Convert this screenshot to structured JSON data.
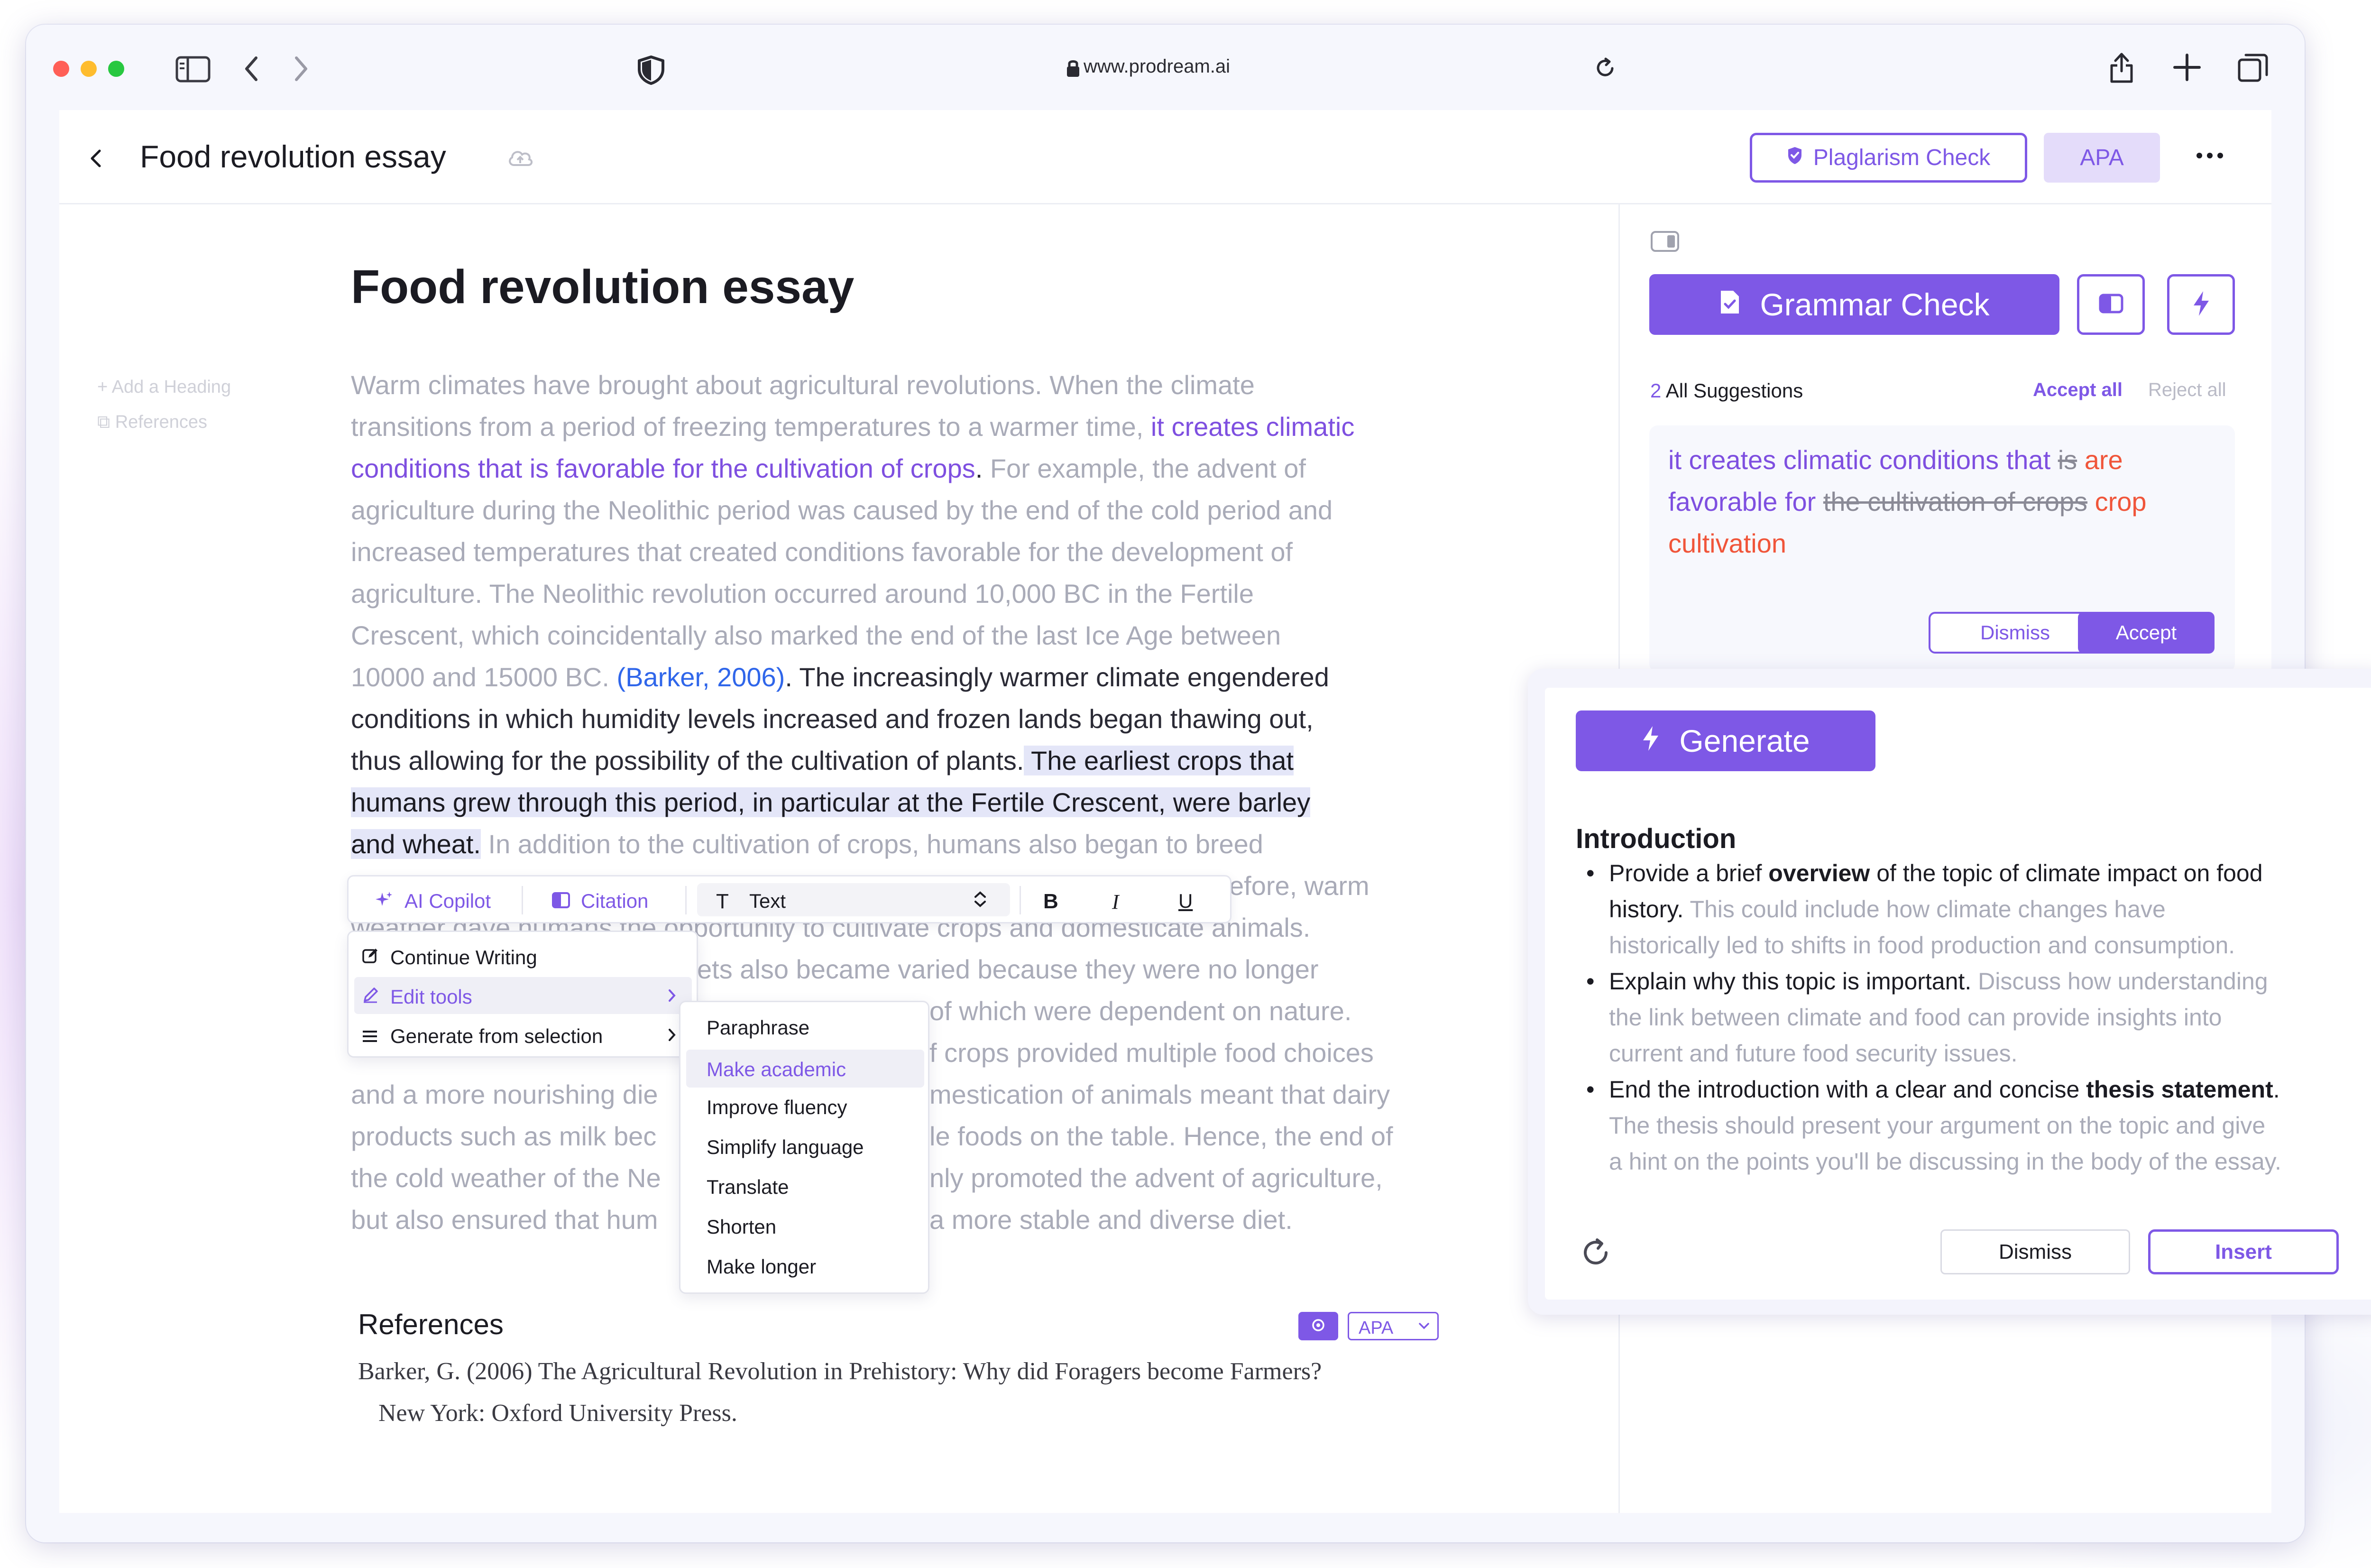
{
  "browser": {
    "url": "www.prodream.ai"
  },
  "header": {
    "title": "Food revolution essay",
    "plagiarism_label": "Plaglarism Check",
    "style_label": "APA"
  },
  "outline": {
    "add_heading": "Add a Heading",
    "references": "References"
  },
  "document": {
    "heading": "Food revolution essay",
    "l1": "Warm climates have brought about agricultural revolutions. When the climate",
    "l2a": "transitions from a period of freezing temperatures to a warmer time,",
    "l2b": " it creates climatic",
    "l3a": "conditions that is favorable for the cultivation of crops",
    "l3b": ".",
    "l3c": " For example, the advent of",
    "l4": "agriculture during the Neolithic period was caused by the end of the cold period and",
    "l5": "increased temperatures that created conditions favorable for the development of",
    "l6": "agriculture. The Neolithic revolution occurred around 10,000 BC in the Fertile",
    "l7": "Crescent, which coincidentally also marked the end of the last Ice Age between",
    "l8a": "10000 and 15000 BC.",
    "l8b": " (Barker, 2006)",
    "l8c": ". The increasingly warmer climate engendered",
    "l9": "conditions in which humidity levels increased and frozen lands began thawing out,",
    "l10a": "thus allowing for the possibility of the cultivation of plants.",
    "l10b": " The earliest crops that",
    "l11": "humans grew through this period, in particular at the Fertile Crescent, were barley",
    "l12a": "and wheat.",
    "l12b": " In addition to the cultivation of crops, humans also began to breed",
    "l13": "efore, warm",
    "l14": "weather gave humans the opportunity to cultivate crops and domesticate animals.",
    "l15": "ets also became varied because they were no longer",
    "l16": "of which were dependent on nature.",
    "l17": "f crops provided multiple food choices",
    "l18a": "and a more nourishing die",
    "l18b": "mestication of animals meant that dairy",
    "l19a": "products such as milk bec",
    "l19b": "le foods on the table. Hence, the end of",
    "l20a": "the cold weather of the Ne",
    "l20b": "nly promoted the advent of agriculture,",
    "l21a": "but also ensured that hum",
    "l21b": "a more stable and diverse diet."
  },
  "toolbar": {
    "ai_copilot": "AI Copilot",
    "citation": "Citation",
    "text_style": "Text",
    "bold": "B",
    "italic": "I",
    "underline": "U"
  },
  "copilot_menu": {
    "items": [
      "Continue Writing",
      "Edit tools",
      "Generate from selection"
    ]
  },
  "edit_tools_menu": {
    "items": [
      "Paraphrase",
      "Make academic",
      "Improve fluency",
      "Simplify language",
      "Translate",
      "Shorten",
      "Make longer"
    ]
  },
  "references": {
    "title": "References",
    "style": "APA",
    "entry_line1": "Barker, G. (2006) The Agricultural Revolution in Prehistory: Why did Foragers become Farmers?",
    "entry_line2": "New York: Oxford University Press."
  },
  "grammar": {
    "button_label": "Grammar Check",
    "count": "2",
    "all_suggestions": "All Suggestions",
    "accept_all": "Accept all",
    "reject_all": "Reject all",
    "s1": "it creates climatic conditions that ",
    "s2": "is",
    "s3": " are",
    "s4": "favorable for ",
    "s5": "the cultivation of crops",
    "s6": " crop",
    "s7": "cultivation",
    "dismiss": "Dismiss",
    "accept": "Accept"
  },
  "generate": {
    "button_label": "Generate",
    "section_title": "Introduction",
    "b1a": "Provide a brief ",
    "b1b": "overview",
    "b1c": " of the topic of climate impact on food",
    "b1d": "history.",
    "b1e": " This could include how climate changes have",
    "b1f": "historically led to shifts in food production and consumption.",
    "b2a": "Explain why this topic is important.",
    "b2b": " Discuss how understanding",
    "b2c": "the link between climate and food can provide insights into",
    "b2d": "current and future food security issues.",
    "b3a": "End the introduction with a clear and concise ",
    "b3b": "thesis statement",
    "b3c": ".",
    "b3d": "The thesis should present your argument on the topic and give",
    "b3e": "a hint on the points you'll be discussing in the body of the essay.",
    "dismiss": "Dismiss",
    "insert": "Insert"
  },
  "colors": {
    "accent": "#7e58e6",
    "link_blue": "#2f66ea",
    "suggestion_red": "#f0553a"
  }
}
